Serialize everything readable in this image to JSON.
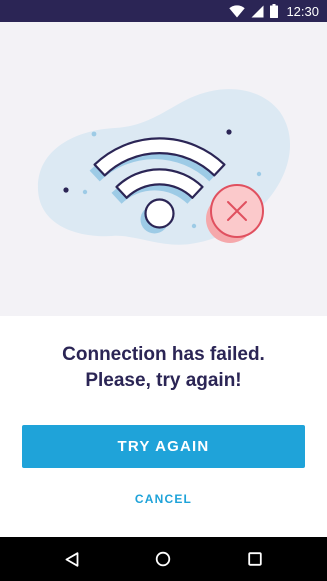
{
  "status_bar": {
    "time": "12:30",
    "icons": [
      "wifi-icon",
      "cellular-signal-icon",
      "battery-icon"
    ]
  },
  "illustration": {
    "name": "wifi-connection-failed-illustration",
    "icons": [
      "wifi-icon",
      "error-x-icon"
    ],
    "colors": {
      "blob": "#dce9f3",
      "outline": "#2b2555",
      "error_fill": "#f9b4b6",
      "error_stroke": "#e0505f"
    }
  },
  "message": {
    "line1": "Connection has failed.",
    "line2": "Please, try again!"
  },
  "actions": {
    "try_again_label": "TRY AGAIN",
    "cancel_label": "CANCEL"
  },
  "nav_bar": {
    "buttons": [
      "back-icon",
      "home-icon",
      "recents-icon"
    ]
  },
  "colors": {
    "status_bar": "#2b2555",
    "hero_background": "#f3f2f6",
    "accent": "#1fa3d9",
    "title_text": "#2b2555"
  }
}
